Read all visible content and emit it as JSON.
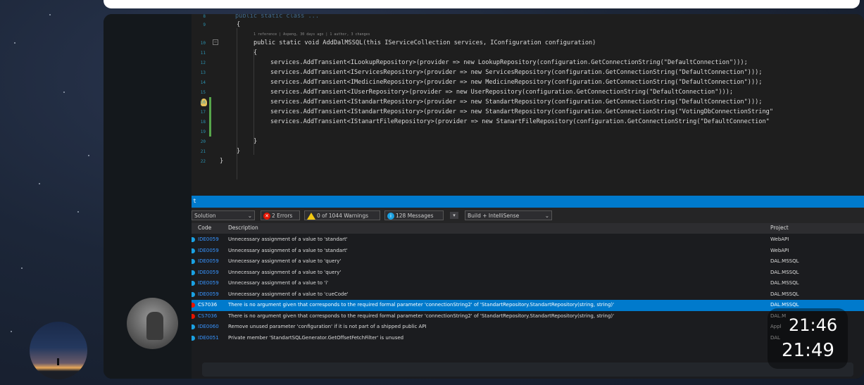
{
  "chat": {
    "message_times": [
      "21:46",
      "21:49"
    ]
  },
  "editor": {
    "code_lines": [
      {
        "n": "8",
        "text": "public static class ..."
      },
      {
        "n": "9",
        "text": "{"
      },
      {
        "n": "10",
        "text": "public static void AddDalMSSQL(this IServiceCollection services, IConfiguration configuration)"
      },
      {
        "n": "11",
        "text": "{"
      },
      {
        "n": "12",
        "text": "services.AddTransient<ILookupRepository>(provider => new LookupRepository(configuration.GetConnectionString(\"DefaultConnection\")));"
      },
      {
        "n": "13",
        "text": "services.AddTransient<IServicesRepository>(provider => new ServicesRepository(configuration.GetConnectionString(\"DefaultConnection\")));"
      },
      {
        "n": "14",
        "text": "services.AddTransient<IMedicineRepository>(provider => new MedicineRepository(configuration.GetConnectionString(\"DefaultConnection\")));"
      },
      {
        "n": "15",
        "text": "services.AddTransient<IUserRepository>(provider => new UserRepository(configuration.GetConnectionString(\"DefaultConnection\")));"
      },
      {
        "n": "16",
        "text": "services.AddTransient<IStandartRepository>(provider => new StandartRepository(configuration.GetConnectionString(\"DefaultConnection\")));"
      },
      {
        "n": "17",
        "text": "services.AddTransient<IStandartRepository>(provider => new StandartRepository(configuration.GetConnectionString(\"VotingDbConnectionString\""
      },
      {
        "n": "18",
        "text": "services.AddTransient<IStanartFileRepository>(provider => new StanartFileRepository(configuration.GetConnectionString(\"DefaultConnection\""
      },
      {
        "n": "19",
        "text": ""
      },
      {
        "n": "20",
        "text": "}"
      },
      {
        "n": "21",
        "text": "}"
      },
      {
        "n": "22",
        "text": "}"
      }
    ],
    "codelens": "1 reference | Aspeng, 30 days ago | 1 author, 3 changes"
  },
  "error_list": {
    "scope": "Solution",
    "errors_label": "2 Errors",
    "warnings_label": "0 of 1044 Warnings",
    "messages_label": "128 Messages",
    "build_filter": "Build + IntelliSense",
    "columns": {
      "code": "Code",
      "description": "Description",
      "project": "Project"
    },
    "rows": [
      {
        "code": "IDE0059",
        "desc": "Unnecessary assignment of a value to 'standart'",
        "project": "WebAPI",
        "type": "info",
        "selected": false
      },
      {
        "code": "IDE0059",
        "desc": "Unnecessary assignment of a value to 'standart'",
        "project": "WebAPI",
        "type": "info",
        "selected": false
      },
      {
        "code": "IDE0059",
        "desc": "Unnecessary assignment of a value to 'query'",
        "project": "DAL.MSSQL",
        "type": "info",
        "selected": false
      },
      {
        "code": "IDE0059",
        "desc": "Unnecessary assignment of a value to 'query'",
        "project": "DAL.MSSQL",
        "type": "info",
        "selected": false
      },
      {
        "code": "IDE0059",
        "desc": "Unnecessary assignment of a value to 'i'",
        "project": "DAL.MSSQL",
        "type": "info",
        "selected": false
      },
      {
        "code": "IDE0059",
        "desc": "Unnecessary assignment of a value to 'cueCode'",
        "project": "DAL.MSSQL",
        "type": "info",
        "selected": false
      },
      {
        "code": "CS7036",
        "desc": "There is no argument given that corresponds to the required formal parameter 'connectionString2' of 'StandartRepository.StandartRepository(string, string)'",
        "project": "DAL.MSSQL",
        "type": "error",
        "selected": true
      },
      {
        "code": "CS7036",
        "desc": "There is no argument given that corresponds to the required formal parameter 'connectionString2' of 'StandartRepository.StandartRepository(string, string)'",
        "project": "DAL.M",
        "type": "error",
        "selected": false
      },
      {
        "code": "IDE0060",
        "desc": "Remove unused parameter 'configuration' if it is not part of a shipped public API",
        "project": "Appl",
        "type": "info",
        "selected": false
      },
      {
        "code": "IDE0051",
        "desc": "Private member 'StandartSQLGenerator.GetOffsetFetchFilter' is unused",
        "project": "DAL",
        "type": "info",
        "selected": false
      }
    ]
  },
  "colors": {
    "accent": "#007acc",
    "error": "#e51400",
    "info": "#1ba1e2"
  }
}
